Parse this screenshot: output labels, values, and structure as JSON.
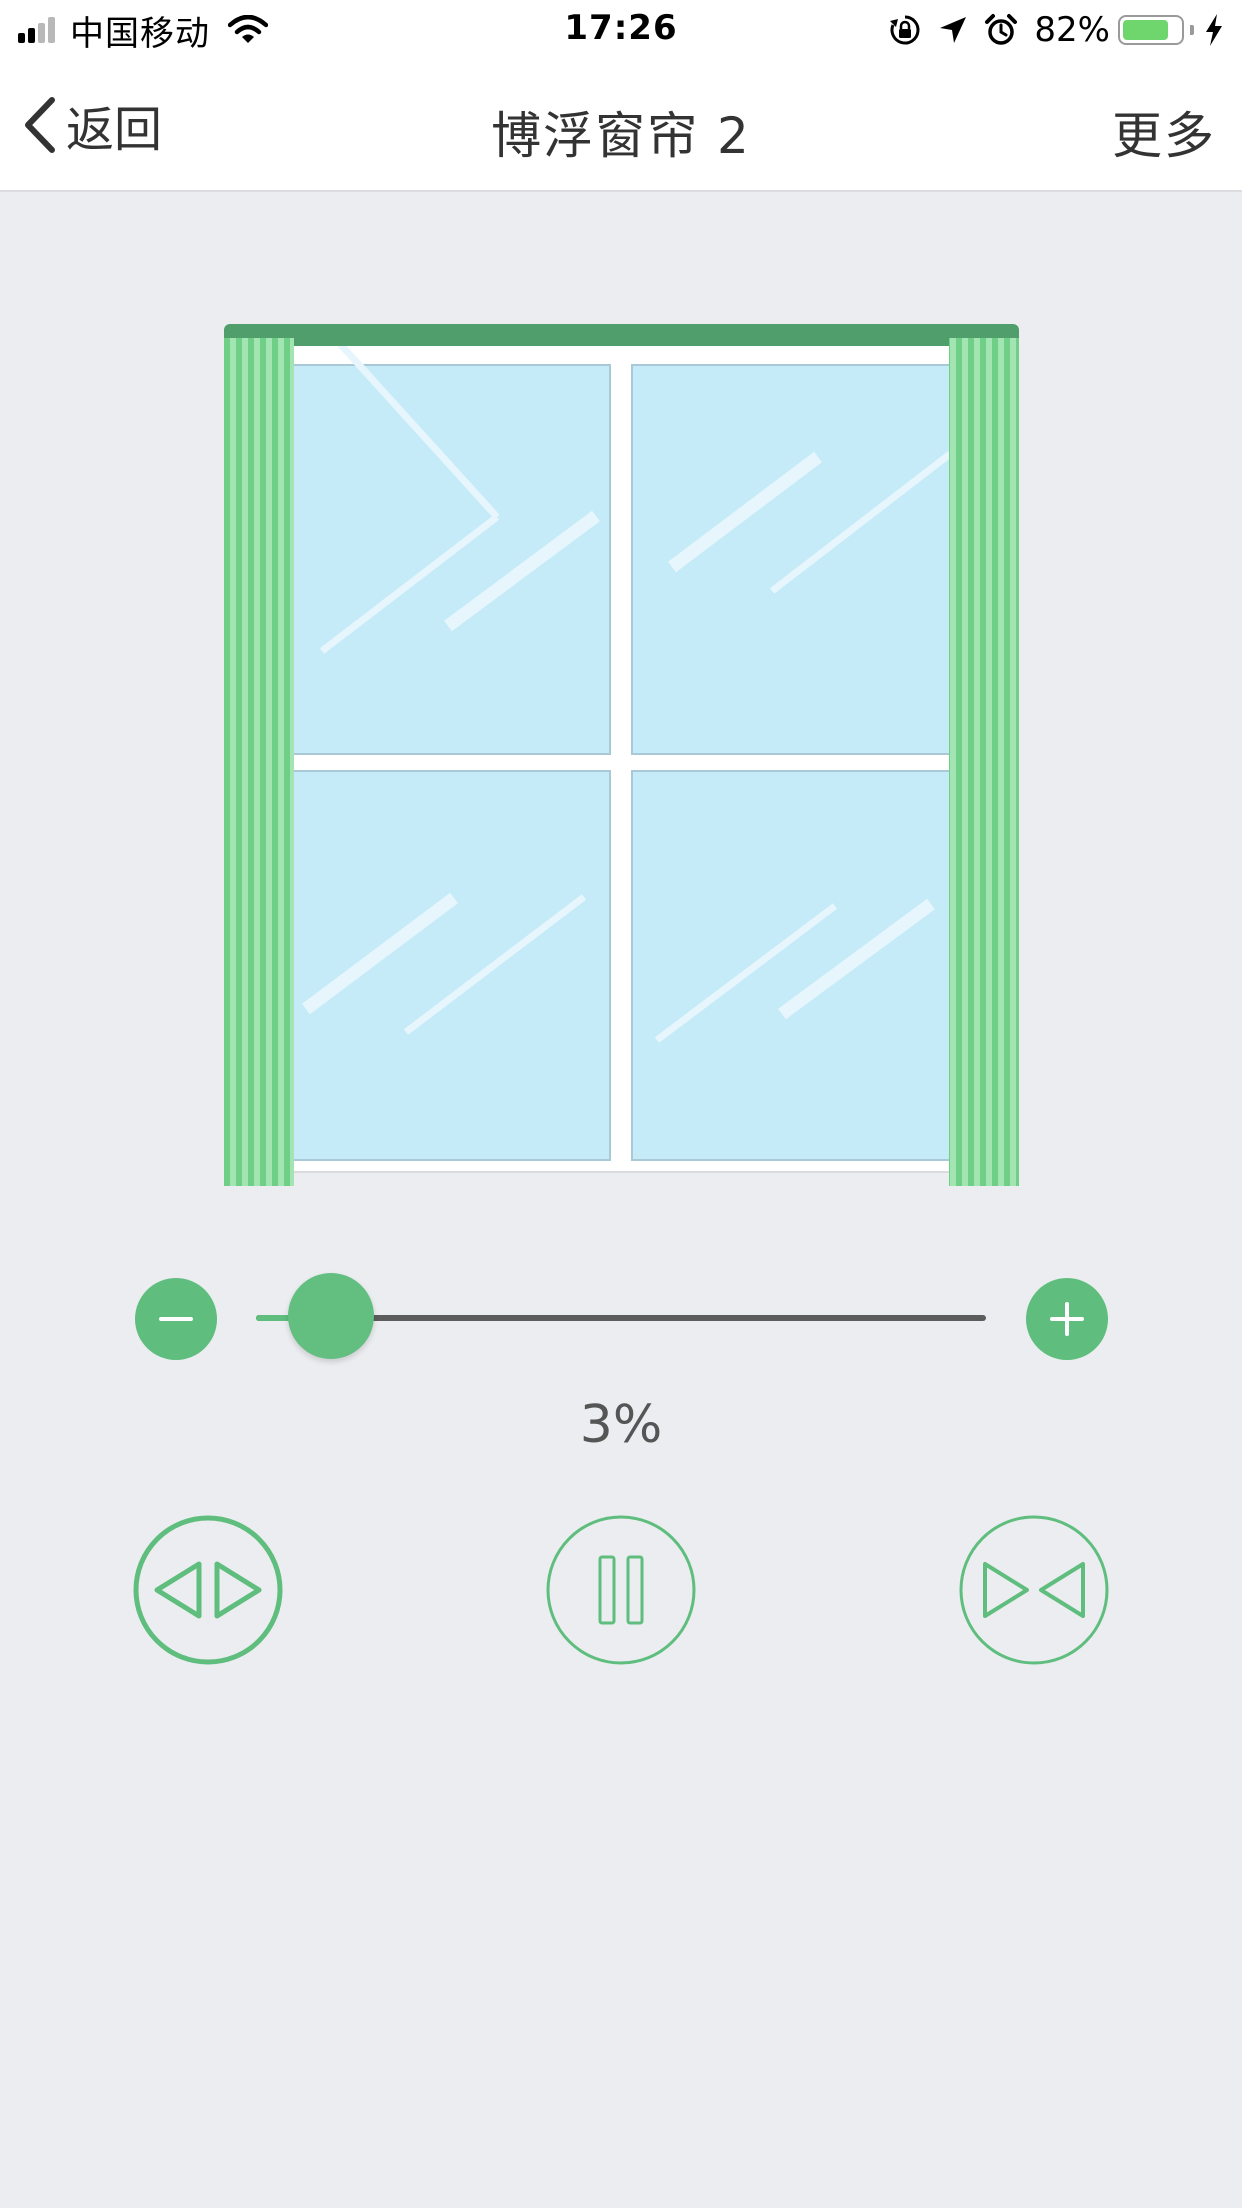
{
  "status_bar": {
    "carrier": "中国移动",
    "time": "17:26",
    "battery_percent": "82%",
    "battery_level": 0.82,
    "icons": [
      "signal-icon",
      "wifi-icon",
      "rotation-lock-icon",
      "location-icon",
      "alarm-icon",
      "battery-icon",
      "charging-icon"
    ]
  },
  "nav": {
    "back_label": "返回",
    "title": "博浮窗帘 2",
    "more_label": "更多"
  },
  "colors": {
    "accent": "#5fbd7d",
    "curtain_rod": "#4f9e6b",
    "glass": "#c5ebf8",
    "background": "#ebedf1"
  },
  "control": {
    "position_percent": 3,
    "percent_label": "3%",
    "buttons": [
      {
        "name": "open-curtain-button",
        "icon": "open-arrows-icon"
      },
      {
        "name": "pause-button",
        "icon": "pause-icon"
      },
      {
        "name": "close-curtain-button",
        "icon": "close-arrows-icon"
      }
    ]
  }
}
